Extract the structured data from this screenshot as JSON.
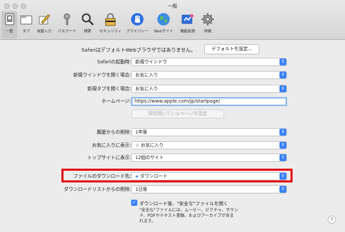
{
  "window": {
    "title": "一般"
  },
  "toolbar": {
    "tabs": [
      {
        "label": "一般",
        "icon": "general-switch-icon"
      },
      {
        "label": "タブ",
        "icon": "tabs-icon"
      },
      {
        "label": "自動入力",
        "icon": "pencil-autofill-icon"
      },
      {
        "label": "パスワード",
        "icon": "key-icon"
      },
      {
        "label": "検索",
        "icon": "search-icon"
      },
      {
        "label": "セキュリティ",
        "icon": "lock-icon"
      },
      {
        "label": "プライバシー",
        "icon": "hand-icon"
      },
      {
        "label": "Webサイト",
        "icon": "globe-icon"
      },
      {
        "label": "機能拡張",
        "icon": "puzzle-icon"
      },
      {
        "label": "詳細",
        "icon": "gear-icon"
      }
    ]
  },
  "default_browser": {
    "message": "SafariはデフォルトWebブラウザではありません。",
    "button_label": "デフォルトを設定..."
  },
  "settings": {
    "launch": {
      "label": "Safariの起動時:",
      "value": "新規ウインドウ"
    },
    "new_window": {
      "label": "新規ウインドウを開く場合:",
      "value": "お気に入り"
    },
    "new_tab": {
      "label": "新規タブを開く場合:",
      "value": "お気に入り"
    },
    "homepage": {
      "label": "ホームページ:",
      "value": "https://www.apple.com/jp/startpage/",
      "button_label": "現在開いているページを指定"
    },
    "history": {
      "label": "履歴からの削除:",
      "value": "1年後"
    },
    "favorites": {
      "label": "お気に入りに表示:",
      "value": "お気に入り"
    },
    "top_sites": {
      "label": "トップサイトに表示:",
      "value": "12個のサイト"
    },
    "download_location": {
      "label": "ファイルのダウンロード先:",
      "value": "ダウンロード"
    },
    "download_list": {
      "label": "ダウンロードリストからの削除:",
      "value": "1日後"
    },
    "safe_files": {
      "label": "ダウンロード後、\"安全な\"ファイルを開く",
      "desc_line1": "\"安全な\"ファイルには、ムービー、ピクチャ、サウン",
      "desc_line2": "ド、PDFやテキスト書類、およびアーカイブが含ま",
      "desc_line3": "れます。",
      "checked": true
    }
  },
  "colors": {
    "accent": "#3b82f6",
    "highlight": "#e60012"
  }
}
